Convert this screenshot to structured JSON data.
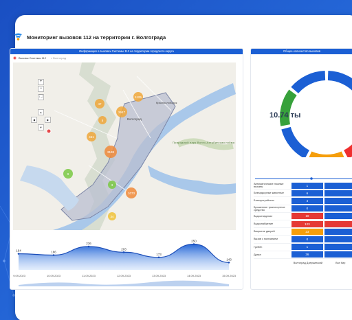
{
  "header": {
    "title": "Мониторинг вызовов 112 на территории г. Волгограда"
  },
  "map_panel": {
    "title": "Информация о вызовах Системы 112 на территории городского округа",
    "legend": {
      "layer": "Вызовы Системы 112",
      "region": "г. Волгоград"
    },
    "controls": {
      "zoom_in": "+",
      "zoom_out": "−",
      "fullscreen": "⛶",
      "nav_up": "▲",
      "nav_left": "◀",
      "nav_right": "▶",
      "nav_down": "▼"
    },
    "place_labels": [
      "Волгоград",
      "Краснослободск",
      "Природный парк Волго-Ахтубинская пойма"
    ],
    "clusters": [
      {
        "value": "47",
        "color": "#f0a73a"
      },
      {
        "value": "1125",
        "color": "#f0a73a"
      },
      {
        "value": "2647",
        "color": "#f0a73a"
      },
      {
        "value": "5",
        "color": "#f0a73a"
      },
      {
        "value": "461",
        "color": "#f0a73a"
      },
      {
        "value": "3188",
        "color": "#f08a3a"
      },
      {
        "value": "9",
        "color": "#7ac943"
      },
      {
        "value": "3",
        "color": "#7ac943"
      },
      {
        "value": "1073",
        "color": "#f08a3a"
      },
      {
        "value": "34",
        "color": "#f0c23a"
      }
    ]
  },
  "spark": {
    "values": [
      194,
      186,
      236,
      203,
      173,
      250,
      143
    ],
    "labels": [
      "194",
      "186",
      "236",
      "203",
      "173",
      "250",
      "143"
    ],
    "dates": [
      "09.09.2023",
      "10.09.2023",
      "11.09.2023",
      "12.09.2023",
      "13.09.2023",
      "14.09.2023",
      "15.09.2023"
    ]
  },
  "summary_panel": {
    "title": "Общее количество вызовов",
    "total_label": "10.74 ты",
    "donut_colors": [
      "#1b5fd4",
      "#37a13b",
      "#ef2e2e",
      "#f59e0b",
      "#1b5fd4",
      "#37a13b",
      "#1b5fd4"
    ]
  },
  "table": {
    "rows": [
      {
        "label": "Автоматические ложные вызовы",
        "c1": "1",
        "c1_color": "#1b5fd4"
      },
      {
        "label": "Безнадзорные животные",
        "c1": "6",
        "c1_color": "#1b5fd4"
      },
      {
        "label": "Благоустройство",
        "c1": "4",
        "c1_color": "#1b5fd4"
      },
      {
        "label": "Брошенное транспортное средство",
        "c1": "0",
        "c1_color": "#1b5fd4"
      },
      {
        "label": "Водоотведение",
        "c1": "10",
        "c1_color": "#e53935"
      },
      {
        "label": "Водоснабжение",
        "c1": "123",
        "c1_color": "#e53935"
      },
      {
        "label": "Вскрытие дверей",
        "c1": "23",
        "c1_color": "#f59e0b"
      },
      {
        "label": "Вызов с молчанием",
        "c1": "0",
        "c1_color": "#1b5fd4"
      },
      {
        "label": "Гребён",
        "c1": "1",
        "c1_color": "#1b5fd4"
      },
      {
        "label": "Драка",
        "c1": "36",
        "c1_color": "#1b5fd4"
      }
    ],
    "col2_colors": [
      "#1b5fd4",
      "#1b5fd4",
      "#1b5fd4",
      "#1b5fd4",
      "#1b5fd4",
      "#e53935",
      "#1b5fd4",
      "#1b5fd4",
      "#1b5fd4",
      "#1b5fd4"
    ],
    "columns": [
      "Волгоград Дзержинский",
      "Вол Кир"
    ]
  }
}
